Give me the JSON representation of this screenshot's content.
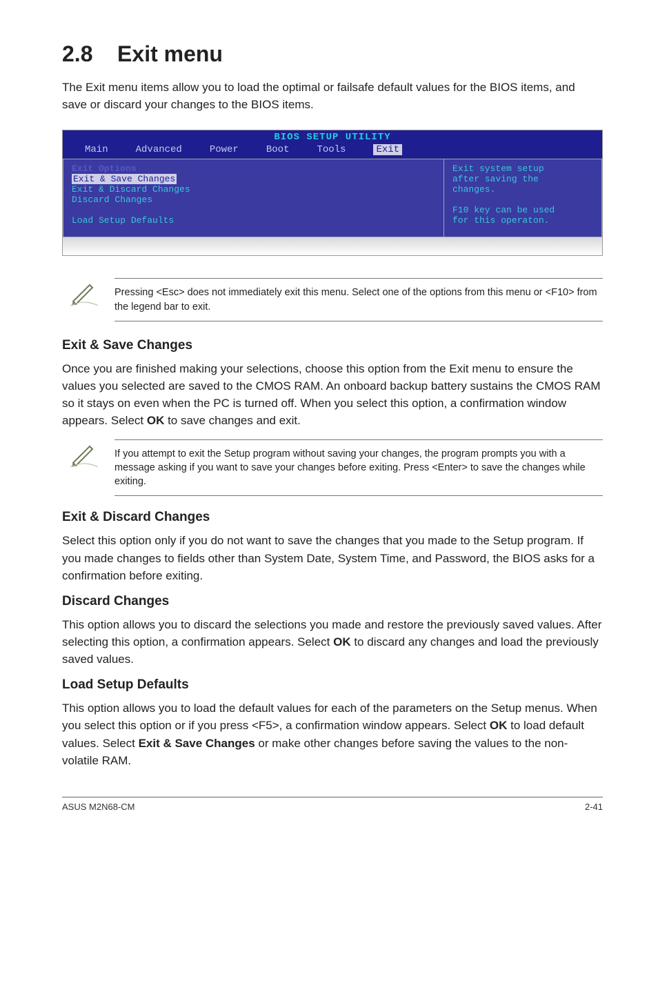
{
  "section_num": "2.8",
  "section_title": "Exit menu",
  "lead_para": "The Exit menu items allow you to load the optimal or failsafe default values for the BIOS items, and save or discard your changes to the BIOS items.",
  "bios": {
    "title": "BIOS SETUP UTILITY",
    "tabs": [
      "Main",
      "Advanced",
      "Power",
      "Boot",
      "Tools",
      "Exit"
    ],
    "selected_tab_index": 5,
    "left_heading": "Exit Options",
    "left_items": [
      {
        "text": "Exit & Save Changes",
        "style": "sel"
      },
      {
        "text": "Exit & Discard Changes",
        "style": "plain"
      },
      {
        "text": "Discard Changes",
        "style": "plain"
      },
      {
        "text": "",
        "style": "gap"
      },
      {
        "text": "Load Setup Defaults",
        "style": "plain"
      }
    ],
    "right_lines": [
      "Exit system setup",
      "after saving the",
      "changes.",
      "",
      "F10 key can be used",
      "for this operaton."
    ]
  },
  "note1": "Pressing <Esc> does not immediately exit this menu. Select one of the options from this menu or <F10> from the legend bar to exit.",
  "sec1_title": "Exit & Save Changes",
  "sec1_para_before_bold": "Once you are finished making your selections, choose this option from the Exit menu to ensure the values you selected are saved to the CMOS RAM. An onboard backup battery sustains the CMOS RAM so it stays on even when the PC is turned off. When you select this option, a confirmation window appears. Select ",
  "sec1_bold": "OK",
  "sec1_para_after_bold": " to save changes and exit.",
  "note2": "If you attempt to exit the Setup program without saving your changes, the program prompts you with a message asking if you want to save your changes before exiting. Press <Enter>  to save the  changes while exiting.",
  "sec2_title": "Exit & Discard Changes",
  "sec2_para": "Select this option only if you do not want to save the changes that you  made to the Setup program. If you made changes to fields other than System Date, System Time, and Password, the BIOS asks for a confirmation before exiting.",
  "sec3_title": "Discard Changes",
  "sec3_para_before_bold": "This option allows you to discard the selections you made and restore the previously saved values. After selecting this option, a confirmation appears. Select ",
  "sec3_bold": "OK",
  "sec3_para_after_bold": " to discard any changes and load the previously saved values.",
  "sec4_title": "Load Setup Defaults",
  "sec4_para_1": "This option allows you to load the default values for each of the parameters on the Setup menus. When you select this option or if you press <F5>, a confirmation window appears. Select ",
  "sec4_bold1": "OK",
  "sec4_para_2": " to load default values. Select ",
  "sec4_bold2": "Exit & Save Changes",
  "sec4_para_3": " or make other changes before saving the values to the non-volatile RAM.",
  "footer_left": "ASUS M2N68-CM",
  "footer_right": "2-41"
}
